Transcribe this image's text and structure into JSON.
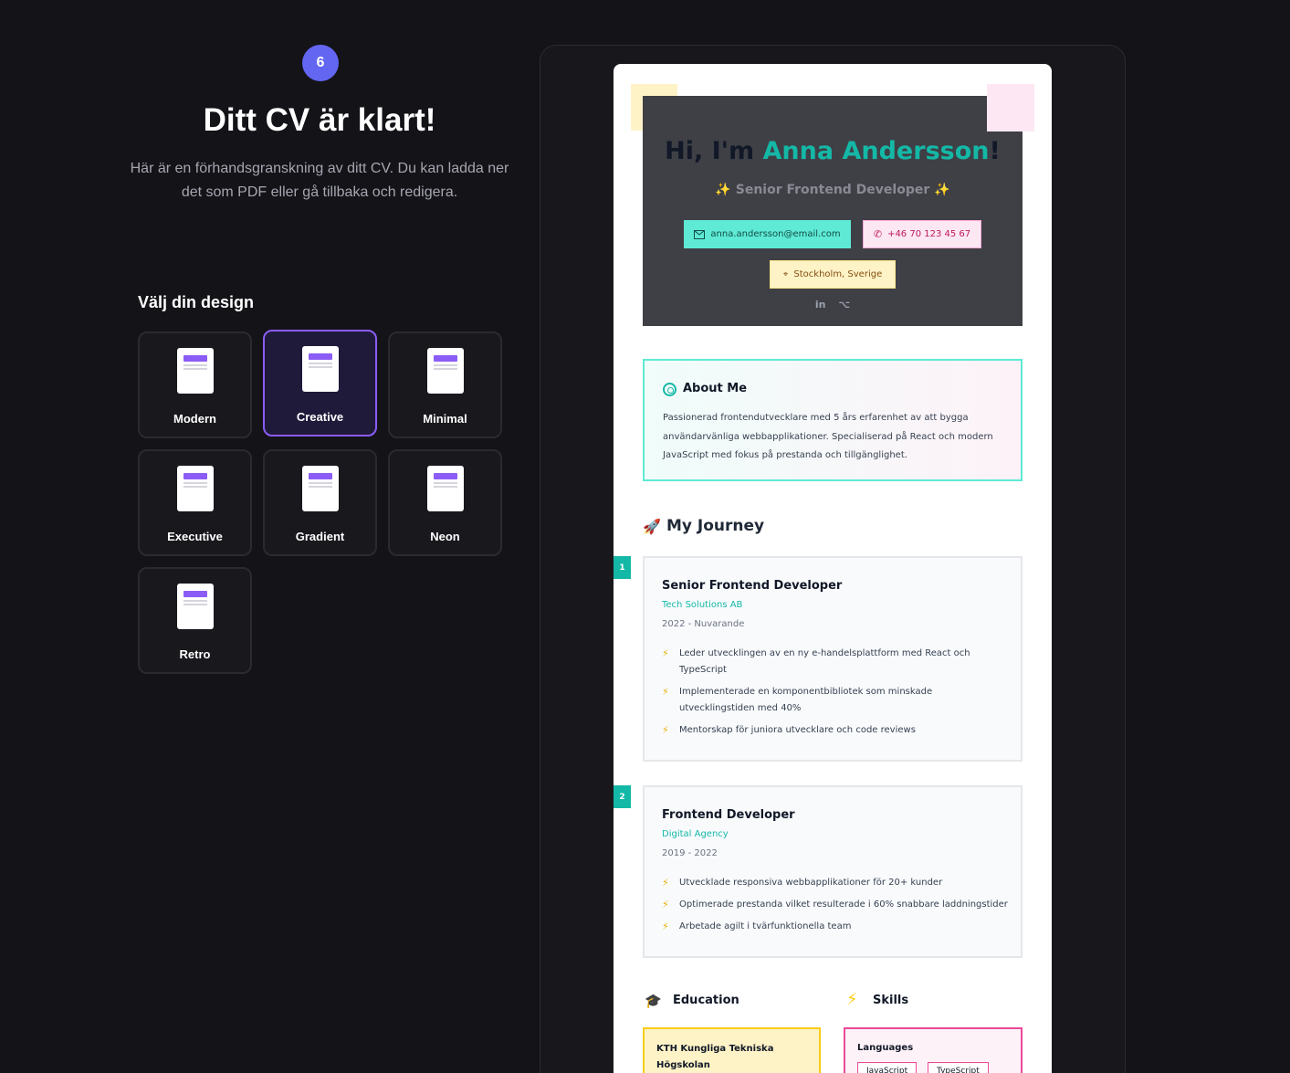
{
  "step": {
    "number": "6"
  },
  "header": {
    "title": "Ditt CV är klart!",
    "subtitle": "Här är en förhandsgranskning av ditt CV. Du kan ladda ner det som PDF eller gå tillbaka och redigera."
  },
  "design": {
    "heading": "Välj din design",
    "selected": "Creative",
    "options": [
      {
        "label": "Modern"
      },
      {
        "label": "Creative"
      },
      {
        "label": "Minimal"
      },
      {
        "label": "Executive"
      },
      {
        "label": "Gradient"
      },
      {
        "label": "Neon"
      },
      {
        "label": "Retro"
      }
    ]
  },
  "cv": {
    "greeting": "Hi, I'm ",
    "name": "Anna Andersson",
    "exclaim": "!",
    "role": "Senior Frontend Developer",
    "contact": {
      "email": "anna.andersson@email.com",
      "phone": "+46 70 123 45 67",
      "location": "Stockholm, Sverige"
    },
    "social_icons": [
      "linkedin-icon",
      "github-icon"
    ],
    "about": {
      "title": "About Me",
      "text": "Passionerad frontendutvecklare med 5 års erfarenhet av att bygga användarvänliga webbapplikationer. Specialiserad på React och modern JavaScript med fokus på prestanda och tillgänglighet."
    },
    "journey": {
      "title": "My Journey",
      "jobs": [
        {
          "num": "1",
          "title": "Senior Frontend Developer",
          "company": "Tech Solutions AB",
          "dates": "2022 - Nuvarande",
          "bullets": [
            "Leder utvecklingen av en ny e-handelsplattform med React och TypeScript",
            "Implementerade en komponentbibliotek som minskade utvecklingstiden med 40%",
            "Mentorskap för juniora utvecklare och code reviews"
          ]
        },
        {
          "num": "2",
          "title": "Frontend Developer",
          "company": "Digital Agency",
          "dates": "2019 - 2022",
          "bullets": [
            "Utvecklade responsiva webbapplikationer för 20+ kunder",
            "Optimerade prestanda vilket resulterade i 60% snabbare laddningstider",
            "Arbetade agilt i tvärfunktionella team"
          ]
        }
      ]
    },
    "education": {
      "title": "Education",
      "school": "KTH Kungliga Tekniska Högskolan"
    },
    "skills": {
      "title": "Skills",
      "category": "Languages",
      "tags": [
        "JavaScript",
        "TypeScript"
      ]
    }
  },
  "colors": {
    "accent": "#6366f1",
    "selected_border": "#8b5cf6",
    "teal": "#14b8a6",
    "pink": "#ec4899",
    "yellow": "#facc15"
  }
}
